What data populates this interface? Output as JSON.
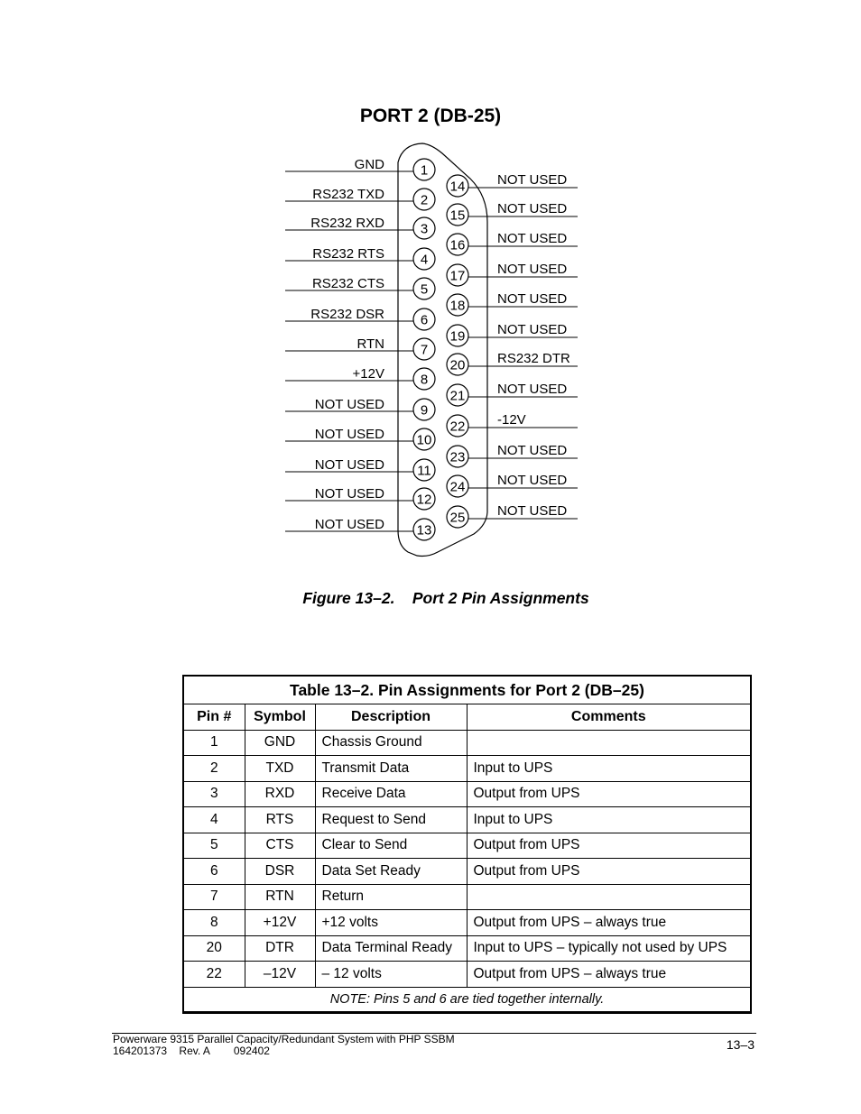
{
  "figure": {
    "title": "PORT 2 (DB-25)",
    "caption": "Figure 13–2.    Port 2 Pin Assignments",
    "left_pins": [
      {
        "pin": "1",
        "label": "GND"
      },
      {
        "pin": "2",
        "label": "RS232 TXD"
      },
      {
        "pin": "3",
        "label": "RS232 RXD"
      },
      {
        "pin": "4",
        "label": "RS232 RTS"
      },
      {
        "pin": "5",
        "label": "RS232 CTS"
      },
      {
        "pin": "6",
        "label": "RS232 DSR"
      },
      {
        "pin": "7",
        "label": "RTN"
      },
      {
        "pin": "8",
        "label": "+12V"
      },
      {
        "pin": "9",
        "label": "NOT USED"
      },
      {
        "pin": "10",
        "label": "NOT USED"
      },
      {
        "pin": "11",
        "label": "NOT USED"
      },
      {
        "pin": "12",
        "label": "NOT USED"
      },
      {
        "pin": "13",
        "label": "NOT USED"
      }
    ],
    "right_pins": [
      {
        "pin": "14",
        "label": "NOT USED"
      },
      {
        "pin": "15",
        "label": "NOT USED"
      },
      {
        "pin": "16",
        "label": "NOT USED"
      },
      {
        "pin": "17",
        "label": "NOT USED"
      },
      {
        "pin": "18",
        "label": "NOT USED"
      },
      {
        "pin": "19",
        "label": "NOT USED"
      },
      {
        "pin": "20",
        "label": "RS232 DTR"
      },
      {
        "pin": "21",
        "label": "NOT USED"
      },
      {
        "pin": "22",
        "label": "-12V"
      },
      {
        "pin": "23",
        "label": "NOT USED"
      },
      {
        "pin": "24",
        "label": "NOT USED"
      },
      {
        "pin": "25",
        "label": "NOT USED"
      }
    ]
  },
  "table": {
    "title": "Table 13–2.  Pin Assignments for Port 2 (DB–25)",
    "headers": [
      "Pin #",
      "Symbol",
      "Description",
      "Comments"
    ],
    "rows": [
      [
        "1",
        "GND",
        "Chassis Ground",
        ""
      ],
      [
        "2",
        "TXD",
        "Transmit Data",
        "Input to UPS"
      ],
      [
        "3",
        "RXD",
        "Receive Data",
        "Output from UPS"
      ],
      [
        "4",
        "RTS",
        "Request to Send",
        "Input to UPS"
      ],
      [
        "5",
        "CTS",
        "Clear to Send",
        "Output from UPS"
      ],
      [
        "6",
        "DSR",
        "Data Set Ready",
        "Output from UPS"
      ],
      [
        "7",
        "RTN",
        "Return",
        ""
      ],
      [
        "8",
        "+12V",
        "+12 volts",
        "Output from UPS – always true"
      ],
      [
        "20",
        "DTR",
        "Data Terminal Ready",
        "Input to UPS – typically not used by UPS"
      ],
      [
        "22",
        "–12V",
        "– 12 volts",
        "Output from UPS – always true"
      ]
    ],
    "note": "NOTE:  Pins 5 and 6 are tied together internally."
  },
  "footer": {
    "line1": "Powerware 9315 Parallel Capacity/Redundant System with PHP SSBM",
    "line2": "164201373    Rev. A        092402",
    "page_number": "13–3"
  }
}
